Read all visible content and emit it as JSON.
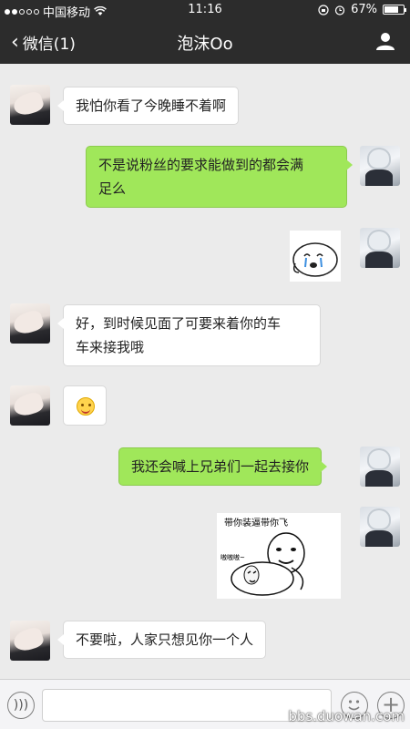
{
  "status": {
    "carrier": "中国移动",
    "time": "11:16",
    "battery": "67%",
    "battery_level": 0.67
  },
  "nav": {
    "back_label": "微信(1)",
    "title": "泡沫Oo"
  },
  "messages": [
    {
      "side": "in",
      "type": "text",
      "text": "我怕你看了今晚睡不着啊"
    },
    {
      "side": "out",
      "type": "text",
      "lines": [
        "不是说粉丝的要求能做到的都会满",
        "足么"
      ]
    },
    {
      "side": "out",
      "type": "sticker",
      "icon": "crying-bun-sticker"
    },
    {
      "side": "in",
      "type": "text",
      "lines": [
        "好，到时候见面了可要来着你的车",
        "车来接我哦"
      ]
    },
    {
      "side": "in",
      "type": "emoji",
      "icon": "smile-emoji"
    },
    {
      "side": "out",
      "type": "text",
      "text": "我还会喊上兄弟们一起去接你"
    },
    {
      "side": "out",
      "type": "sticker",
      "caption_top": "带你装逼带你飞",
      "caption_side": "嗷嗷嗷~"
    },
    {
      "side": "in",
      "type": "text",
      "text": "不要啦，人家只想见你一个人"
    }
  ],
  "watermark": "bbs.duowan.com",
  "colors": {
    "outgoing_bubble": "#a0e75a",
    "incoming_bubble": "#ffffff",
    "bar": "#2c2c2c"
  }
}
